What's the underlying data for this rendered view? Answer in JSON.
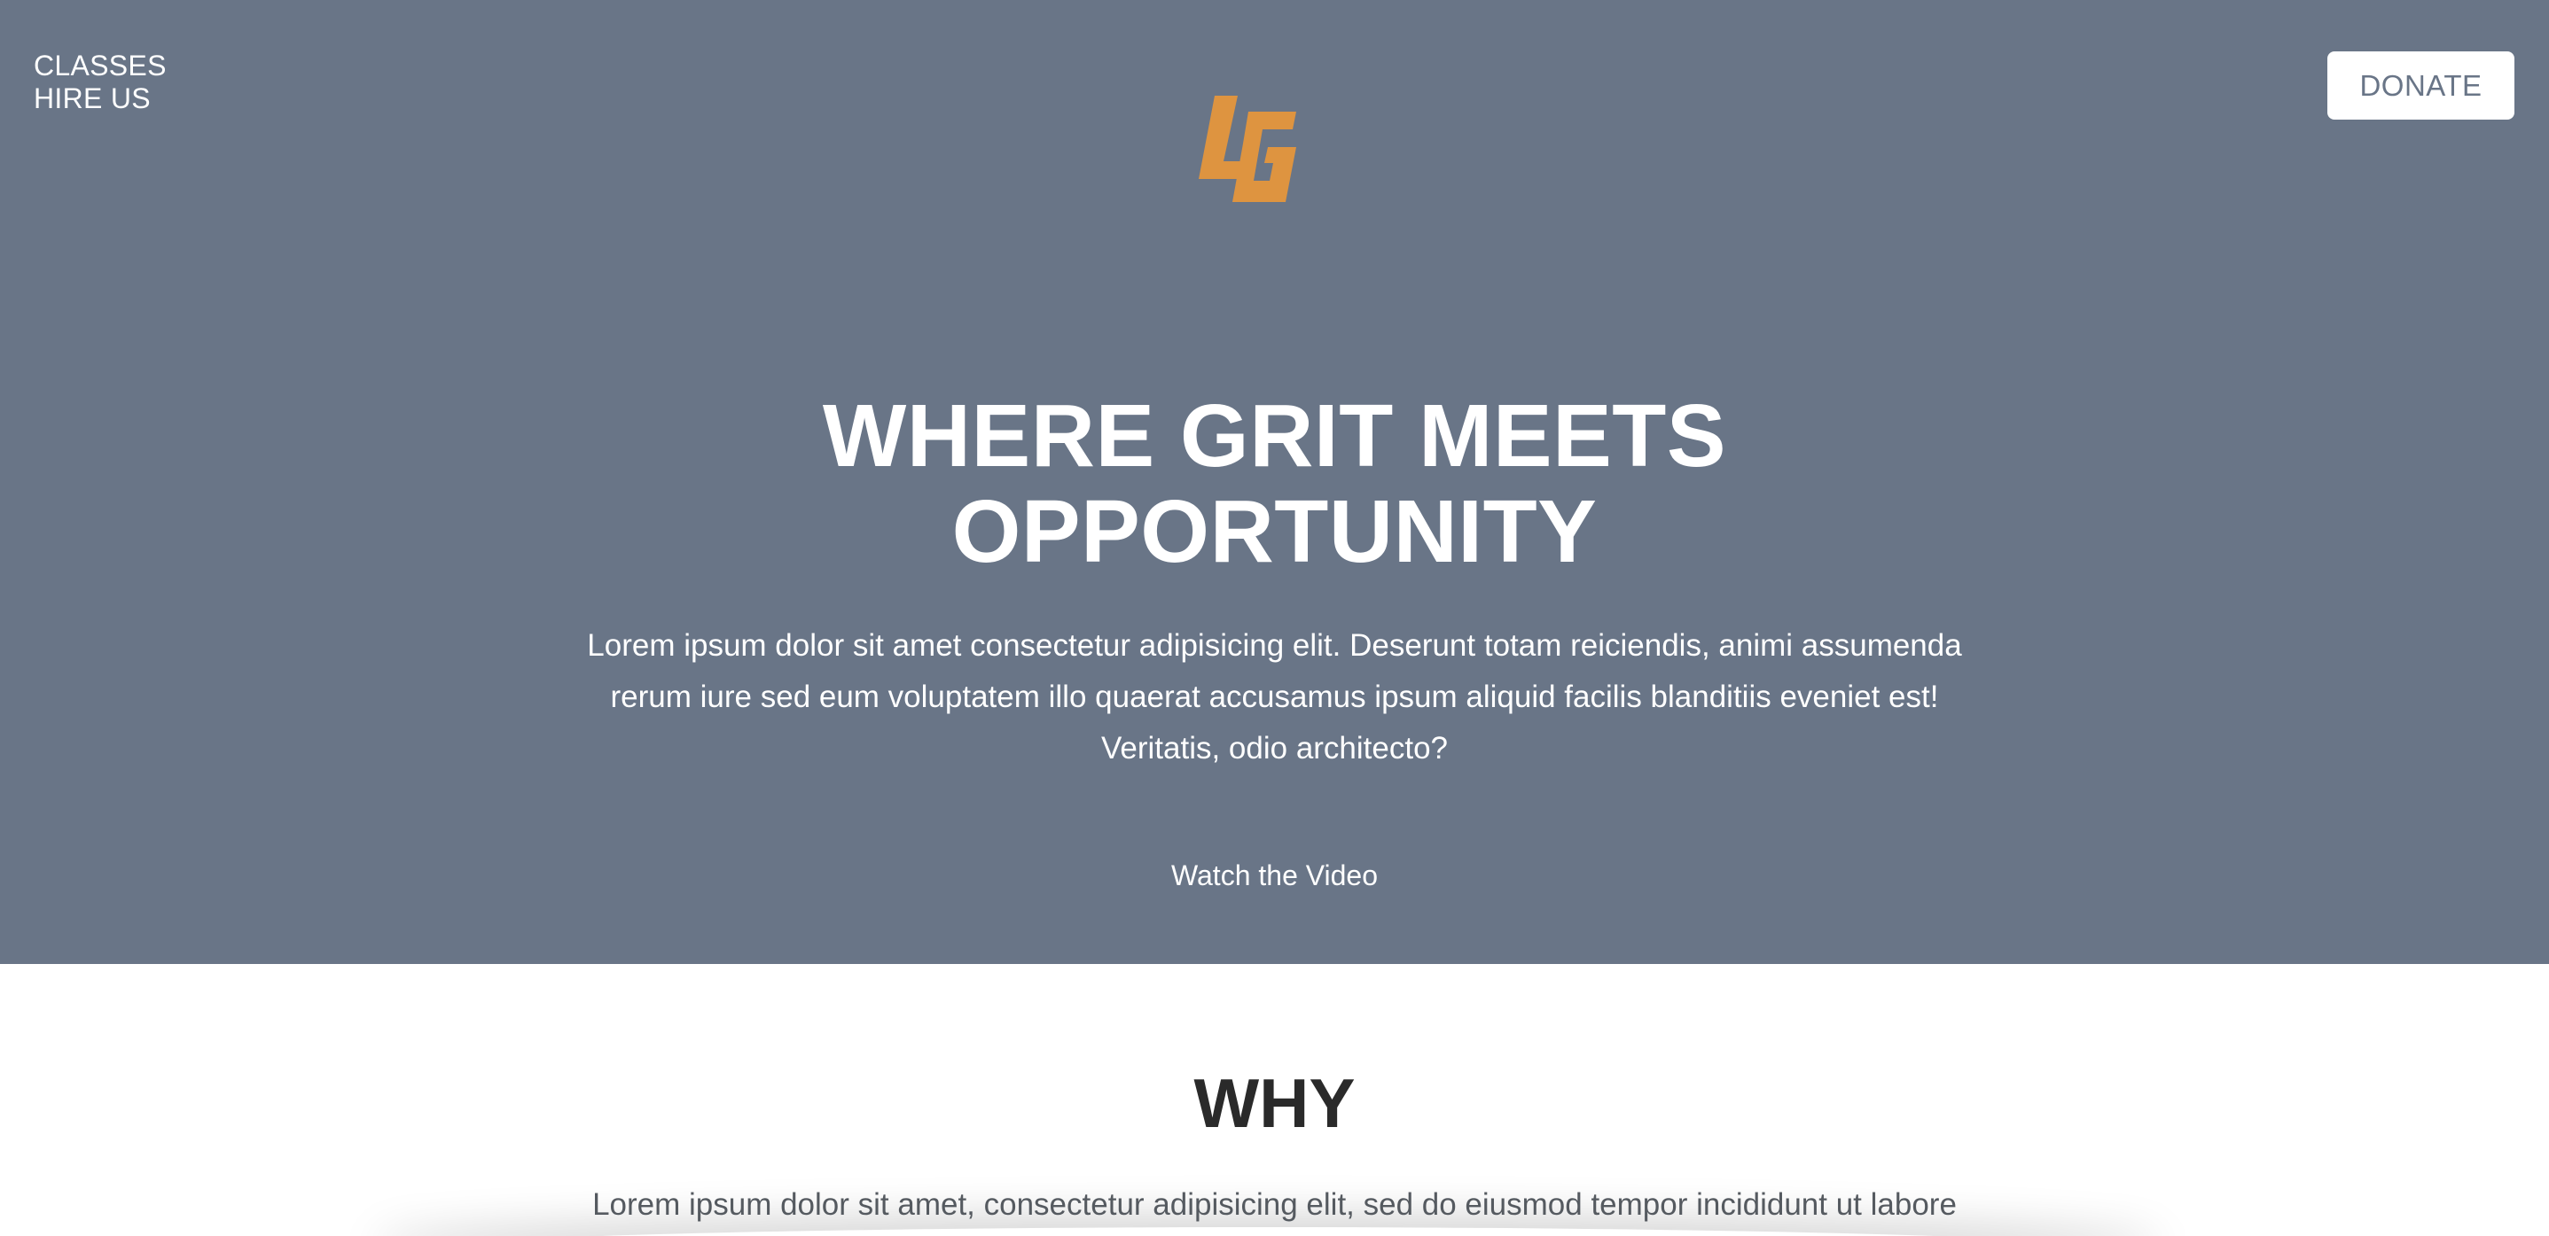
{
  "nav": {
    "links": [
      "CLASSES",
      "HIRE US"
    ],
    "donate_label": "DONATE"
  },
  "logo": {
    "text": "LG",
    "color": "#DE9440"
  },
  "hero": {
    "title_line1": "WHERE GRIT MEETS",
    "title_line2": "OPPORTUNITY",
    "text_line1": "Lorem ipsum dolor sit amet consectetur adipisicing elit. Deserunt totam reiciendis, animi assumenda",
    "text_line2": "rerum iure sed eum voluptatem illo quaerat accusamus ipsum aliquid facilis blanditiis eveniet est!",
    "text_line3": "Veritatis, odio architecto?",
    "video_link": "Watch the Video",
    "background": "#697587"
  },
  "why": {
    "title": "WHY",
    "text": "Lorem ipsum dolor sit amet, consectetur adipisicing elit, sed do eiusmod tempor incididunt ut labore"
  }
}
